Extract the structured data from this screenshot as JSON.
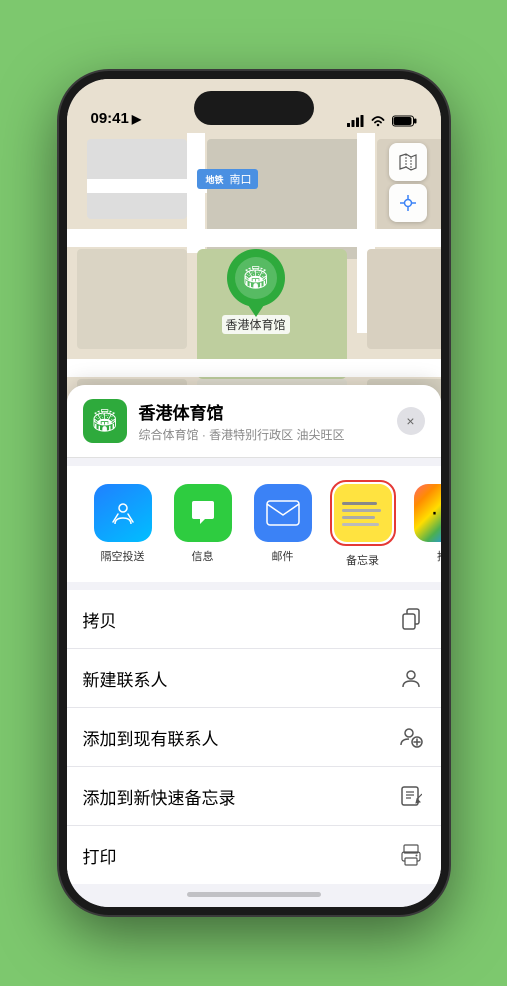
{
  "statusBar": {
    "time": "09:41",
    "locationArrow": "▶"
  },
  "mapControls": {
    "mapIcon": "🗺",
    "locationIcon": "➤"
  },
  "stationLabel": {
    "text": "南口"
  },
  "mapPin": {
    "emoji": "🏟",
    "label": "香港体育馆"
  },
  "locationCard": {
    "name": "香港体育馆",
    "subtitle": "综合体育馆 · 香港特别行政区 油尖旺区",
    "closeLabel": "×"
  },
  "shareItems": [
    {
      "id": "airdrop",
      "label": "隔空投送",
      "type": "airdrop"
    },
    {
      "id": "messages",
      "label": "信息",
      "type": "messages"
    },
    {
      "id": "mail",
      "label": "邮件",
      "type": "mail"
    },
    {
      "id": "notes",
      "label": "备忘录",
      "type": "notes"
    },
    {
      "id": "more",
      "label": "推",
      "type": "more"
    }
  ],
  "actionRows": [
    {
      "label": "拷贝",
      "iconType": "copy"
    },
    {
      "label": "新建联系人",
      "iconType": "person"
    },
    {
      "label": "添加到现有联系人",
      "iconType": "person-add"
    },
    {
      "label": "添加到新快速备忘录",
      "iconType": "memo"
    },
    {
      "label": "打印",
      "iconType": "printer"
    }
  ]
}
